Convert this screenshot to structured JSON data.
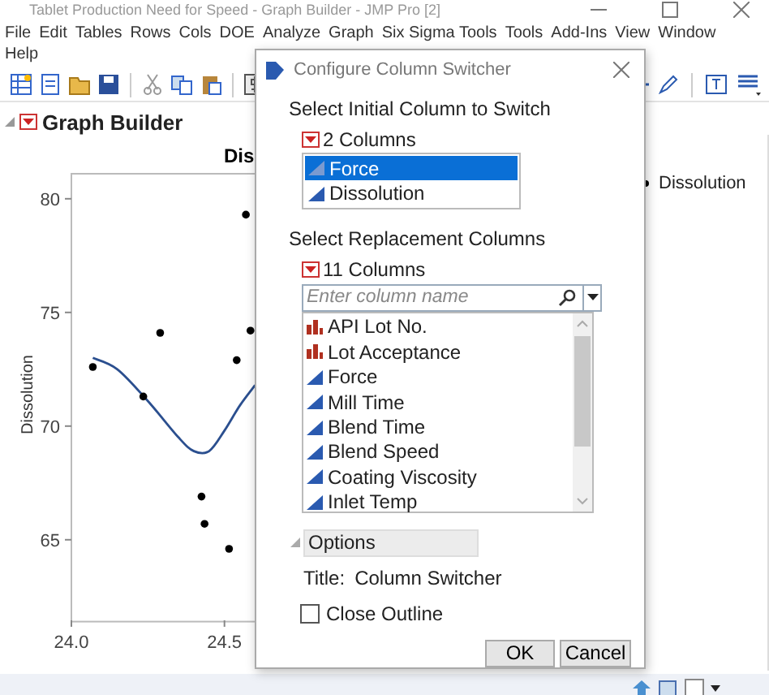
{
  "window": {
    "title": "Tablet Production Need for Speed - Graph Builder - JMP Pro [2]"
  },
  "menu_bar": {
    "rows": [
      [
        "File",
        "Edit",
        "Tables",
        "Rows",
        "Cols",
        "DOE",
        "Analyze",
        "Graph",
        "Six Sigma Tools",
        "Tools",
        "Add-Ins",
        "View",
        "Window"
      ],
      [
        "Help"
      ]
    ]
  },
  "graph_builder": {
    "title": "Graph Builder",
    "chart_data": {
      "type": "scatter",
      "title": "Dis",
      "ylabel": "Dissolution",
      "x": [
        24.07,
        24.235,
        24.29,
        24.425,
        24.435,
        24.515,
        24.54,
        24.57,
        24.585
      ],
      "series": [
        {
          "name": "Dissolution",
          "type": "scatter",
          "color": "#000000",
          "values": [
            72.6,
            71.3,
            74.1,
            66.9,
            65.7,
            64.6,
            72.9,
            79.3,
            74.2
          ]
        },
        {
          "type": "line",
          "color": "#2b4f8f",
          "x": [
            24.07,
            24.15,
            24.25,
            24.35,
            24.4,
            24.45,
            24.5,
            24.55,
            24.6
          ],
          "values": [
            73.0,
            72.5,
            71.1,
            69.5,
            68.9,
            68.9,
            69.8,
            70.9,
            71.8
          ]
        }
      ],
      "xlim": [
        24.0,
        24.62
      ],
      "ylim": [
        61.4,
        81.1
      ],
      "yticks": [
        65,
        70,
        75,
        80
      ],
      "xticks": [
        {
          "value": 24,
          "label": "24.0"
        },
        {
          "value": 24.5,
          "label": "24.5"
        }
      ]
    }
  },
  "dialog": {
    "title": "Configure Column Switcher",
    "initial_section": {
      "heading": "Select Initial Column to Switch",
      "count": "2 Columns",
      "items": [
        {
          "label": "Force",
          "kind": "continuous",
          "selected": true
        },
        {
          "label": "Dissolution",
          "kind": "continuous",
          "selected": false
        }
      ]
    },
    "replacement_section": {
      "heading": "Select Replacement Columns",
      "count": "11 Columns",
      "search": {
        "placeholder": "Enter column name"
      },
      "items": [
        {
          "label": "API Lot No.",
          "kind": "nominal",
          "selected": false
        },
        {
          "label": "Lot Acceptance",
          "kind": "nominal",
          "selected": false
        },
        {
          "label": "Force",
          "kind": "continuous",
          "selected": false
        },
        {
          "label": "Mill Time",
          "kind": "continuous",
          "selected": false
        },
        {
          "label": "Blend Time",
          "kind": "continuous",
          "selected": false
        },
        {
          "label": "Blend Speed",
          "kind": "continuous",
          "selected": false
        },
        {
          "label": "Coating Viscosity",
          "kind": "continuous",
          "selected": false
        },
        {
          "label": "Inlet Temp",
          "kind": "continuous",
          "selected": false
        }
      ]
    },
    "options": {
      "heading": "Options",
      "title_label": "Title:",
      "title_value": "Column Switcher",
      "close_outline": {
        "label": "Close Outline",
        "checked": false
      }
    },
    "buttons": [
      "OK",
      "Cancel"
    ]
  }
}
